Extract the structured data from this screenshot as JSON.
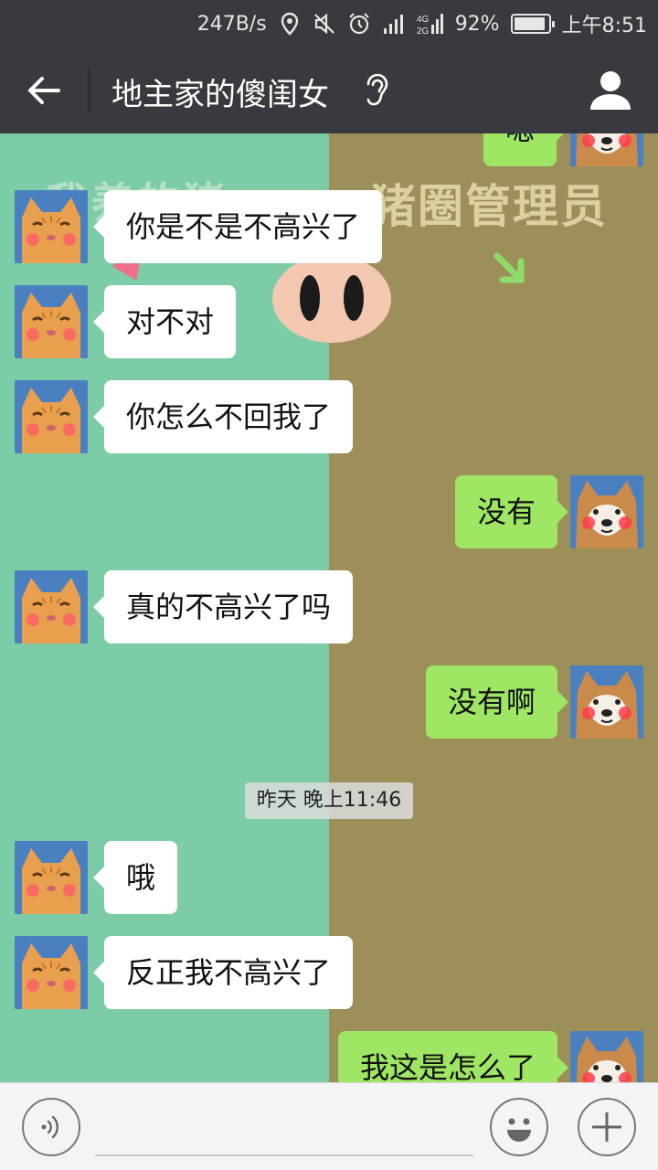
{
  "status_bar": {
    "net_speed": "247B/s",
    "network": "4G 2G",
    "battery": "92%",
    "battery_level": 0.92,
    "time": "上午8:51"
  },
  "header": {
    "title": "地主家的傻闺女",
    "back_icon": "arrow-left-icon",
    "ear_icon": "ear-icon",
    "profile_icon": "person-icon"
  },
  "background": {
    "left_text": "我养的猪",
    "right_text": "猪圈管理员"
  },
  "messages": [
    {
      "side": "right",
      "text": "嗯"
    },
    {
      "side": "left",
      "text": "你是不是不高兴了"
    },
    {
      "side": "left",
      "text": "对不对"
    },
    {
      "side": "left",
      "text": "你怎么不回我了"
    },
    {
      "side": "right",
      "text": "没有"
    },
    {
      "side": "left",
      "text": "真的不高兴了吗"
    },
    {
      "side": "right",
      "text": "没有啊"
    },
    {
      "side": "left",
      "text": "哦"
    },
    {
      "side": "left",
      "text": "反正我不高兴了"
    },
    {
      "side": "right",
      "text": "我这是怎么了"
    }
  ],
  "timestamp": "昨天 晚上11:46",
  "input_bar": {
    "voice_icon": "voice-icon",
    "emoji_icon": "smiley-icon",
    "plus_icon": "plus-icon",
    "text_value": ""
  },
  "colors": {
    "header_bg": "#393a3f",
    "bubble_right": "#9ee663",
    "bubble_left": "#ffffff",
    "bg_left": "#7ccca8",
    "bg_right": "#9c8f5a"
  }
}
